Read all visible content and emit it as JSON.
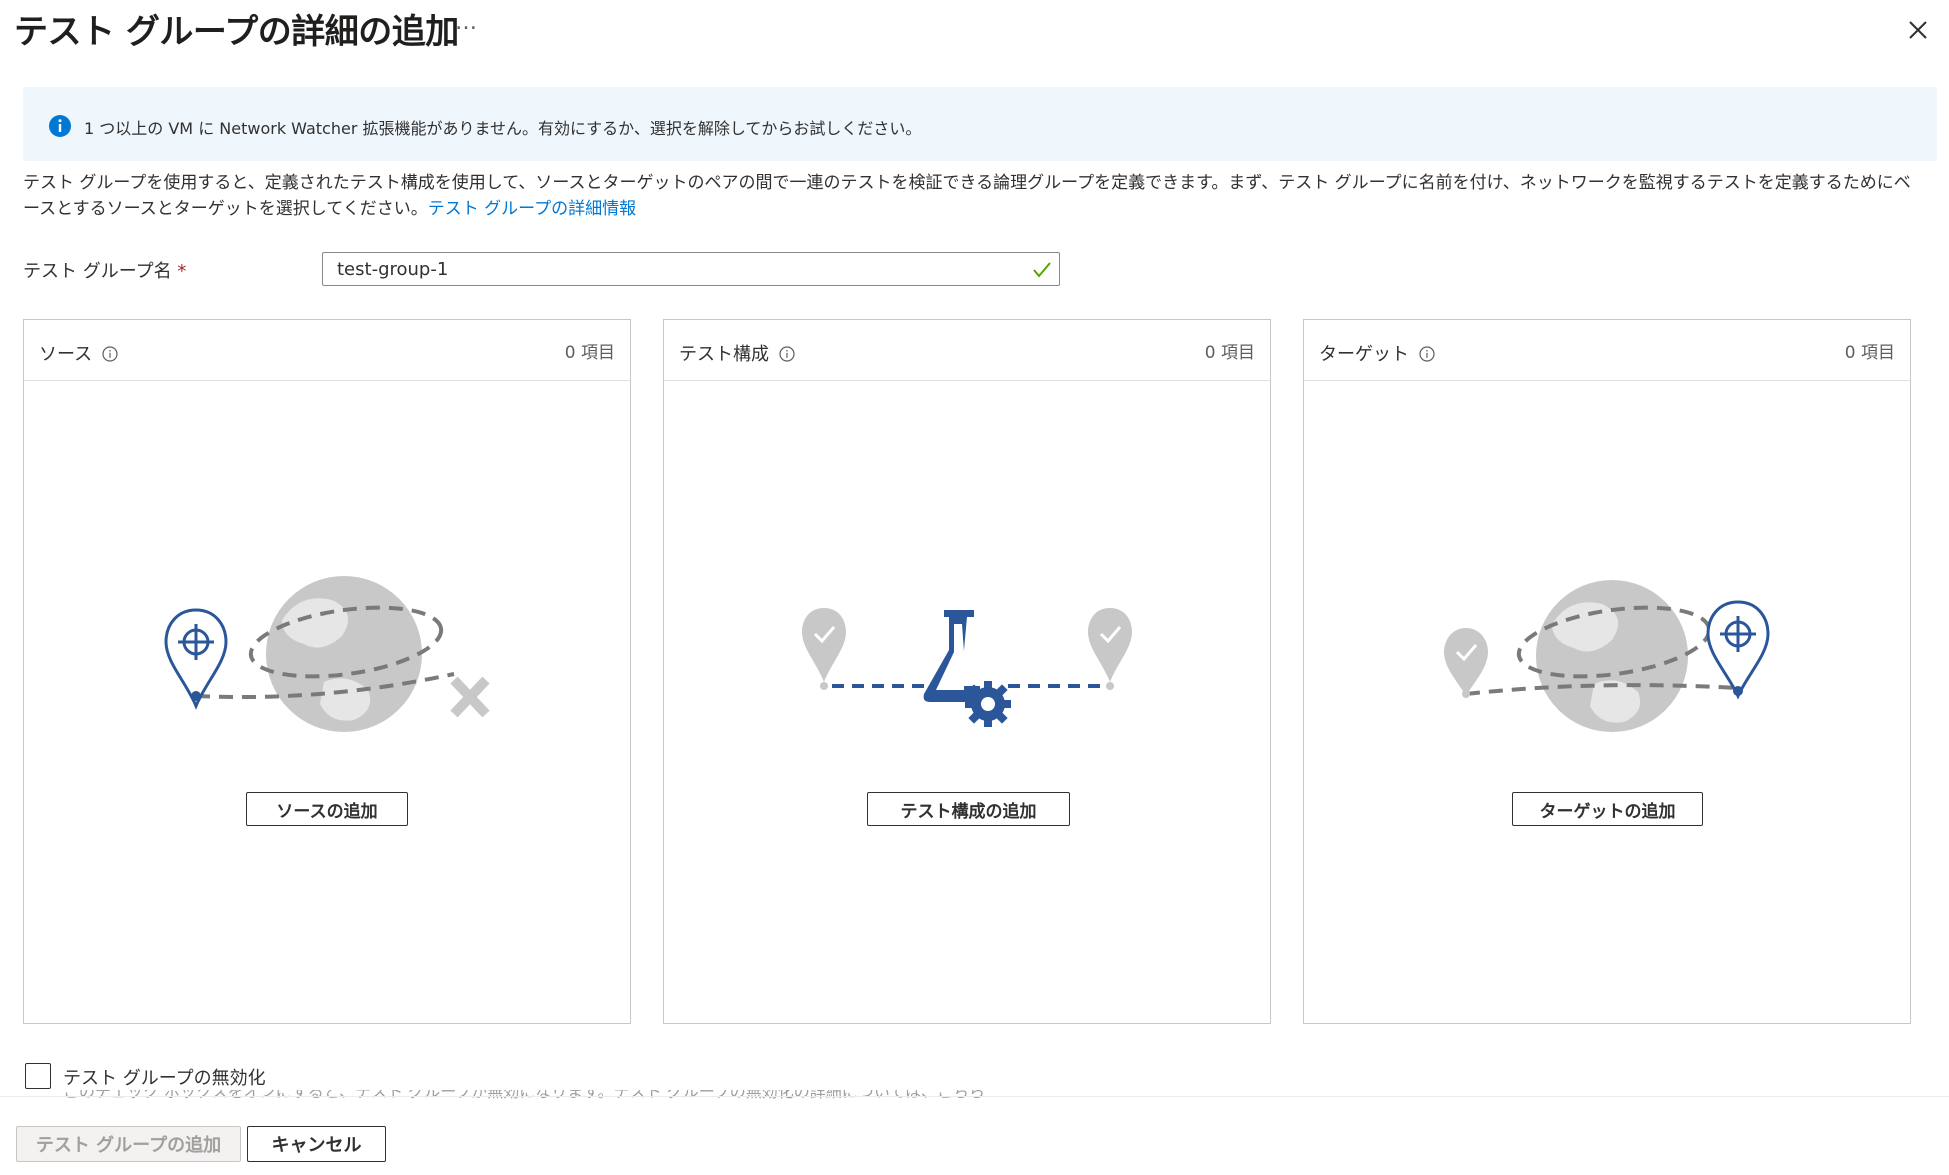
{
  "header": {
    "title": "テスト グループの詳細の追加",
    "more_label": "…",
    "close_icon": "close-icon"
  },
  "info_bar": {
    "icon": "info-icon",
    "text": "1 つ以上の VM に Network Watcher 拡張機能がありません。有効にするか、選択を解除してからお試しください。",
    "icon_color": "#0078d4"
  },
  "description": {
    "text": "テスト グループを使用すると、定義されたテスト構成を使用して、ソースとターゲットのペアの間で一連のテストを検証できる論理グループを定義できます。まず、テスト グループに名前を付け、ネットワークを監視するテストを定義するためにベースとするソースとターゲットを選択してください。",
    "link": "テスト グループの詳細情報"
  },
  "form": {
    "name_label": "テスト グループ名",
    "required_marker": "*",
    "name_value": "test-group-1",
    "valid_icon": "checkmark-icon",
    "valid_color": "#57a300"
  },
  "panels": [
    {
      "title": "ソース",
      "count": "0 項目",
      "button": "ソースの追加",
      "icon": "globe-source-icon"
    },
    {
      "title": "テスト構成",
      "count": "0 項目",
      "button": "テスト構成の追加",
      "icon": "flask-gear-icon"
    },
    {
      "title": "ターゲット",
      "count": "0 項目",
      "button": "ターゲットの追加",
      "icon": "globe-target-icon"
    }
  ],
  "disable": {
    "label": "テスト グループの無効化",
    "checked": false,
    "helper_text": "このチェック ボックスをオンにすると、テスト グループが無効になります。テスト グループの無効化の詳細については、こちらを参照してください。"
  },
  "footer": {
    "add_button": "テスト グループの追加",
    "cancel_button": "キャンセル"
  },
  "colors": {
    "accent": "#0078d4",
    "illustration_blue": "#2b579a",
    "illustration_gray": "#c8c8c8"
  }
}
